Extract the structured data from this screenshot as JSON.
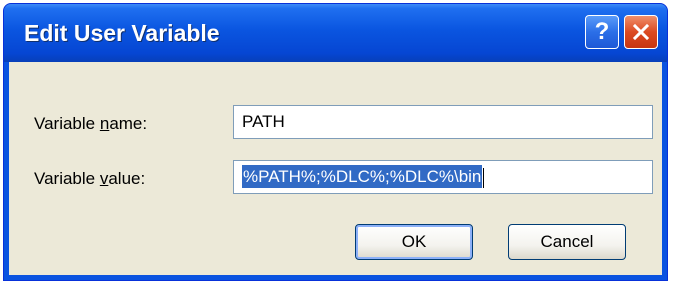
{
  "dialog": {
    "title": "Edit User Variable",
    "help_label": "?",
    "close_icon": "close-icon"
  },
  "form": {
    "name_label_pre": "Variable ",
    "name_label_mnemonic": "n",
    "name_label_post": "ame:",
    "name_value": "PATH",
    "value_label_pre": "Variable ",
    "value_label_mnemonic": "v",
    "value_label_post": "alue:",
    "value_value": "%PATH%;%DLC%;%DLC%\\bin"
  },
  "buttons": {
    "ok_label": "OK",
    "cancel_label": "Cancel"
  },
  "colors": {
    "titlebar": "#0a55e0",
    "selection": "#316ac5",
    "close": "#dc4a22"
  }
}
